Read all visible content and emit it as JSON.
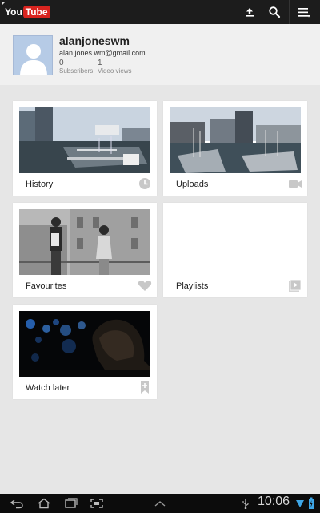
{
  "app": {
    "logo_you": "You",
    "logo_tube": "Tube"
  },
  "actionbar": {
    "icons": [
      "upload-icon",
      "search-icon",
      "menu-icon"
    ]
  },
  "profile": {
    "username": "alanjoneswm",
    "email": "alan.jones.wm@gmail.com",
    "subscribers_count": "0",
    "subscribers_label": "Subscribers",
    "views_count": "1",
    "views_label": "Video views"
  },
  "tiles": [
    {
      "label": "History",
      "icon": "clock-icon"
    },
    {
      "label": "Uploads",
      "icon": "video-camera-icon"
    },
    {
      "label": "Favourites",
      "icon": "heart-icon"
    },
    {
      "label": "Playlists",
      "icon": "playlist-icon"
    },
    {
      "label": "Watch later",
      "icon": "bookmark-add-icon"
    }
  ],
  "statusbar": {
    "time": "10:06",
    "icons": [
      "usb-icon",
      "wifi-icon",
      "battery-icon"
    ]
  },
  "colors": {
    "brand_red": "#d8241f",
    "action_bar": "#1c1c1c",
    "background": "#e6e6e6"
  }
}
